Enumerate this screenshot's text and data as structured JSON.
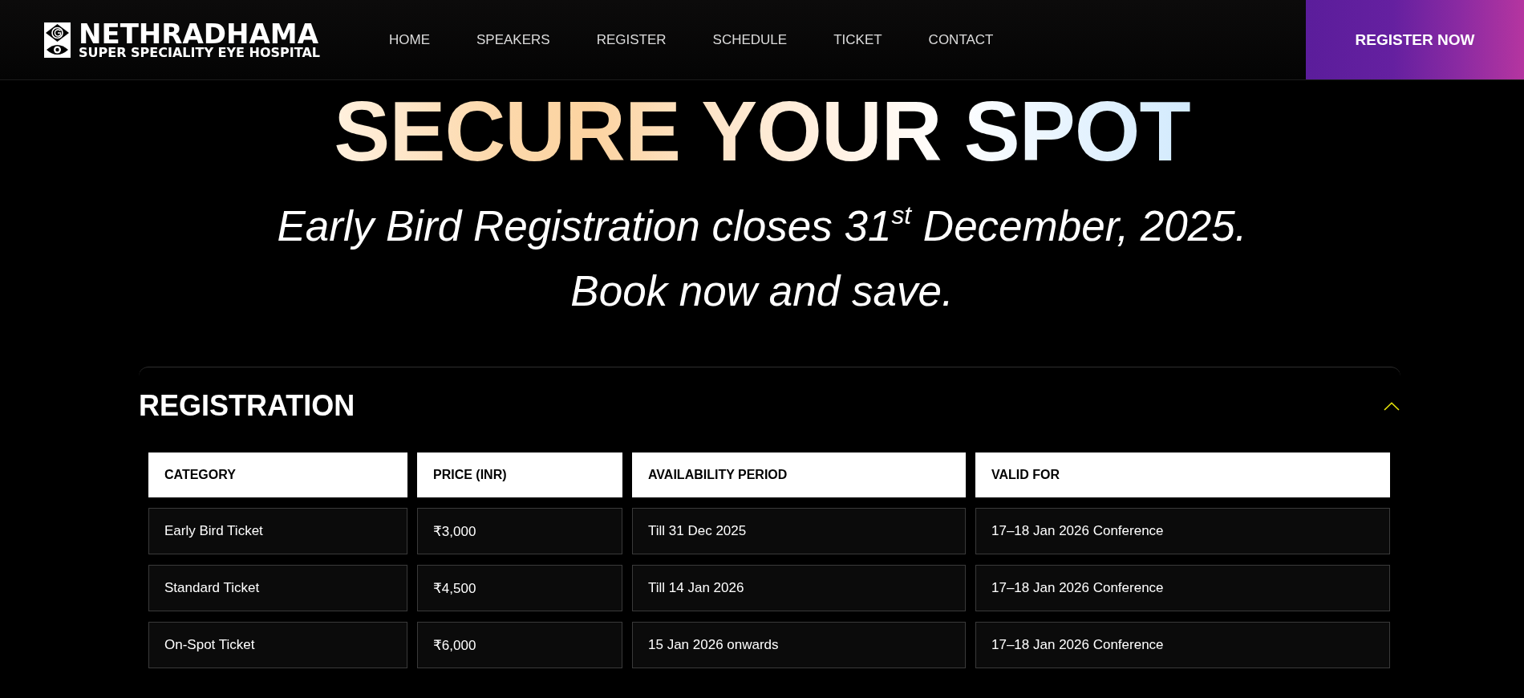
{
  "header": {
    "logo": {
      "name": "NETHRADHAMA",
      "tagline": "SUPER SPECIALITY EYE HOSPITAL"
    },
    "nav": [
      "HOME",
      "SPEAKERS",
      "REGISTER",
      "SCHEDULE",
      "TICKET",
      "CONTACT"
    ],
    "cta": "REGISTER NOW"
  },
  "hero": {
    "title": "SECURE YOUR SPOT",
    "lines": [
      "Early Bird Registration closes 31$^{st}$ December, 2025.",
      "Book now and save."
    ]
  },
  "registration": {
    "title": "REGISTRATION",
    "expanded": true,
    "table": {
      "columns": [
        "CATEGORY",
        "PRICE (INR)",
        "AVAILABILITY PERIOD",
        "VALID FOR"
      ],
      "rows": [
        [
          "Early Bird Ticket",
          "₹3,000",
          "Till 31 Dec 2025",
          "17–18 Jan 2026 Conference"
        ],
        [
          "Standard Ticket",
          "₹4,500",
          "Till 14 Jan 2026",
          "17–18 Jan 2026 Conference"
        ],
        [
          "On-Spot Ticket",
          "₹6,000",
          "15 Jan 2026 onwards",
          "17–18 Jan 2026 Conference"
        ]
      ]
    }
  }
}
